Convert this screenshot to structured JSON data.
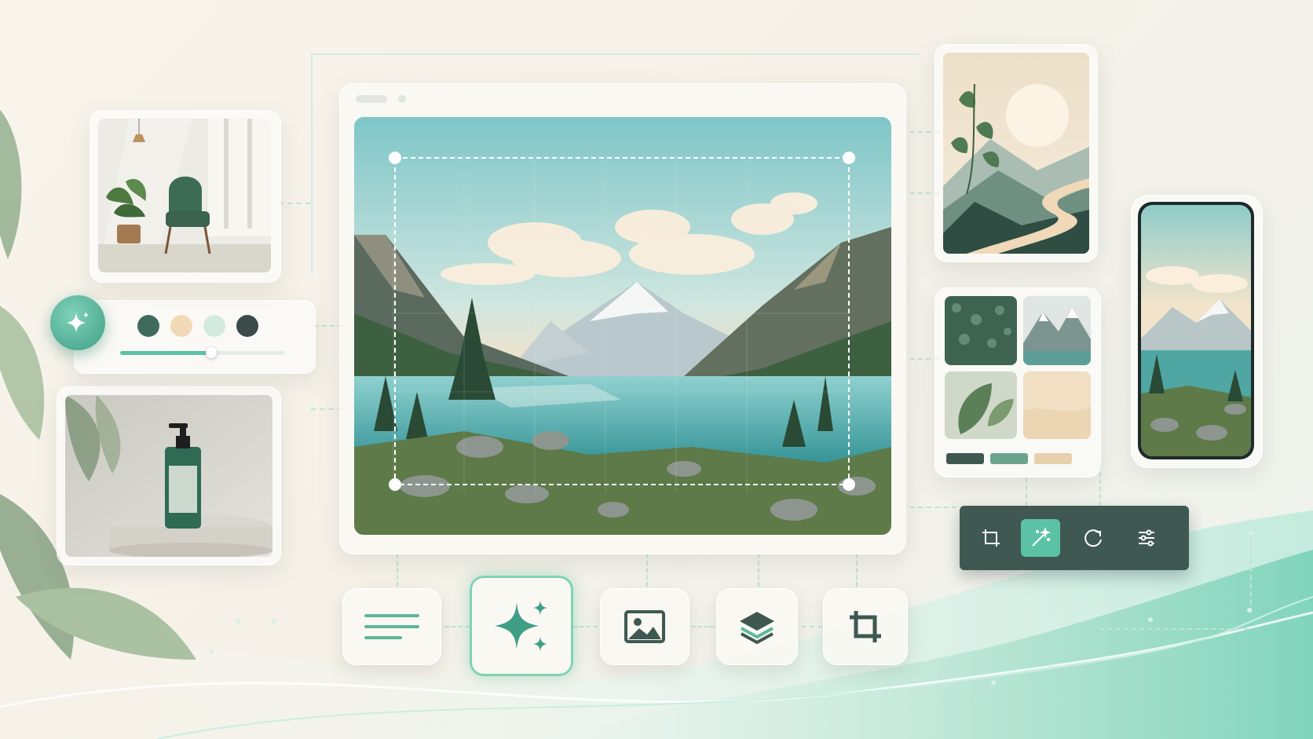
{
  "colors": {
    "accent": "#5cc2a6",
    "dark": "#3f5852",
    "cream": "#f6f1e7"
  },
  "palette": {
    "swatches": [
      "#3f6b5d",
      "#f1d9b5",
      "#d3ebdf",
      "#3b4b4a"
    ],
    "slider_level": 0.55
  },
  "editor": {
    "window_controls": [
      "minimize-pill",
      "close-dot"
    ]
  },
  "quick_tools": {
    "buttons": [
      "crop-icon",
      "magic-wand-icon",
      "rotate-icon",
      "sliders-icon"
    ],
    "active": "magic-wand-icon"
  },
  "bottom_tools": {
    "buttons": [
      "text-lines-icon",
      "sparkle-icon",
      "image-icon",
      "layers-icon",
      "crop-icon"
    ],
    "active": "sparkle-icon"
  },
  "moodboard": {
    "swatches": [
      "#3f5852",
      "#6aa48e",
      "#e8d0ad"
    ]
  }
}
